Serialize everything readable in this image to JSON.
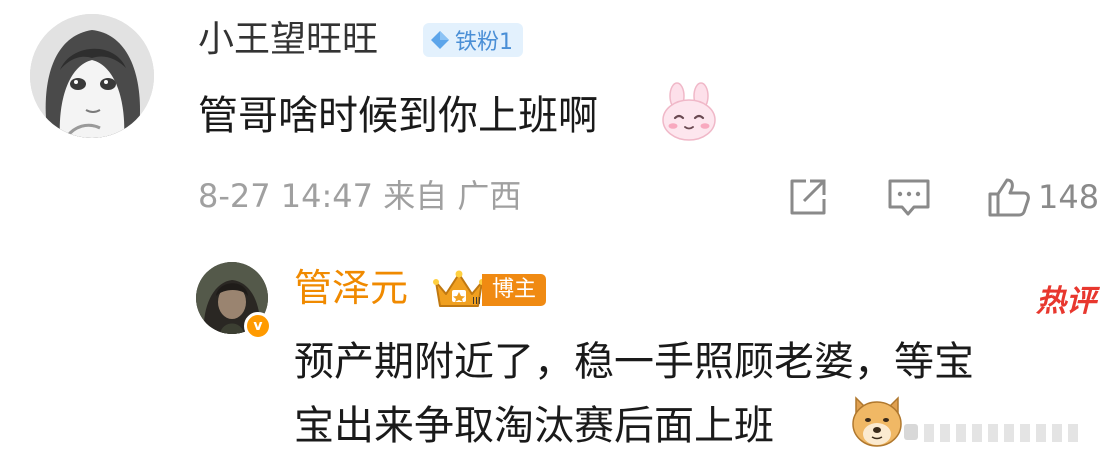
{
  "comment": {
    "username": "小王望旺旺",
    "fan_badge": "铁粉1",
    "text": "管哥啥时候到你上班啊",
    "emoji": "bunny-emoji",
    "meta": "8-27 14:47 来自 广西",
    "like_count": "148",
    "icons": [
      "share-icon",
      "comment-icon",
      "thumbs-up-icon"
    ]
  },
  "reply": {
    "username": "管泽元",
    "role_badge": "博主",
    "hot_label": "热评",
    "text_line1": "预产期附近了，稳一手照顾老婆，等宝",
    "text_line2": "宝出来争取淘汰赛后面上班",
    "emoji": "doge-emoji"
  },
  "colors": {
    "reply_name": "#f08a00",
    "host_badge_bg": "#f08a12",
    "fan_badge_bg": "#e3f1fd",
    "fan_badge_text": "#4a8fd6",
    "hot_label": "#e8372e",
    "meta_text": "#a0a0a0"
  }
}
